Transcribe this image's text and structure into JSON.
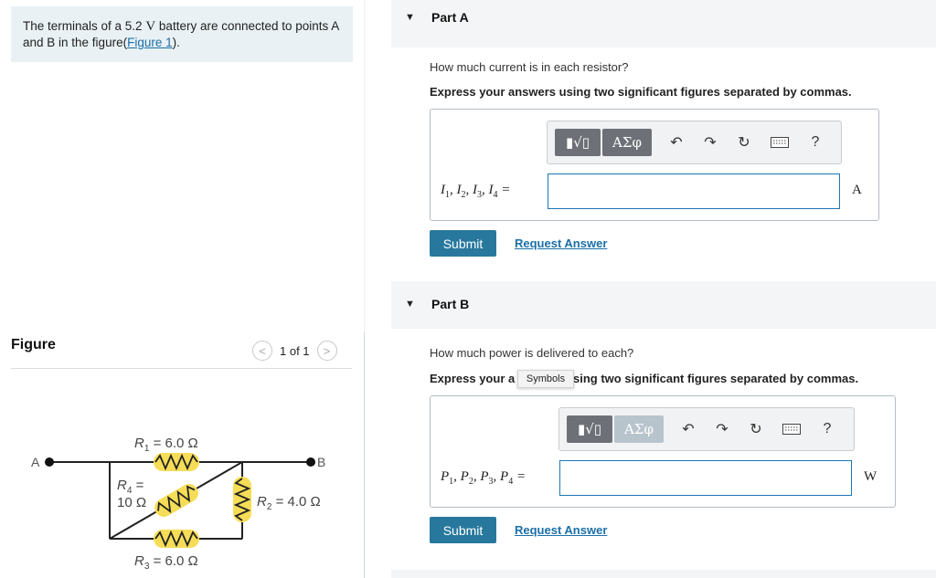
{
  "problem": {
    "text_before": "The terminals of a 5.2 ",
    "unit": "V",
    "text_after": " battery are connected to points A and B in the figure(",
    "link": "Figure 1",
    "text_end": ")."
  },
  "figure_panel": {
    "title": "Figure",
    "pager_text": "1 of 1",
    "prev_glyph": "<",
    "next_glyph": ">",
    "circuit": {
      "point_a": "A",
      "point_b": "B",
      "r1": "R1 = 6.0 Ω",
      "r2": "R2 = 4.0 Ω",
      "r3": "R3 = 6.0 Ω",
      "r4_line1": "R4 =",
      "r4_line2": "10 Ω"
    }
  },
  "part_a": {
    "caret": "▼",
    "title": "Part A",
    "question": "How much current is in each resistor?",
    "instruction": "Express your answers using two significant figures separated by commas.",
    "toolbar": {
      "templates": "▮√▯",
      "symbols": "ΑΣφ",
      "help": "?"
    },
    "equation_label": "I1, I2, I3, I4 =",
    "input_value": "",
    "unit": "A",
    "submit": "Submit",
    "request": "Request Answer"
  },
  "part_b": {
    "caret": "▼",
    "title": "Part B",
    "question": "How much power is delivered to each?",
    "instruction_start": "Express your a",
    "instruction_end": "sing two significant figures separated by commas.",
    "tooltip": "Symbols",
    "toolbar": {
      "templates": "▮√▯",
      "symbols": "ΑΣφ",
      "help": "?"
    },
    "equation_label": "P1, P2, P3, P4 =",
    "input_value": "",
    "unit": "W",
    "submit": "Submit",
    "request": "Request Answer"
  },
  "colors": {
    "accent": "#28789e",
    "link": "#1a6fa8",
    "resistor_highlight": "#f6dd57",
    "info_box": "#e9f1f5"
  }
}
